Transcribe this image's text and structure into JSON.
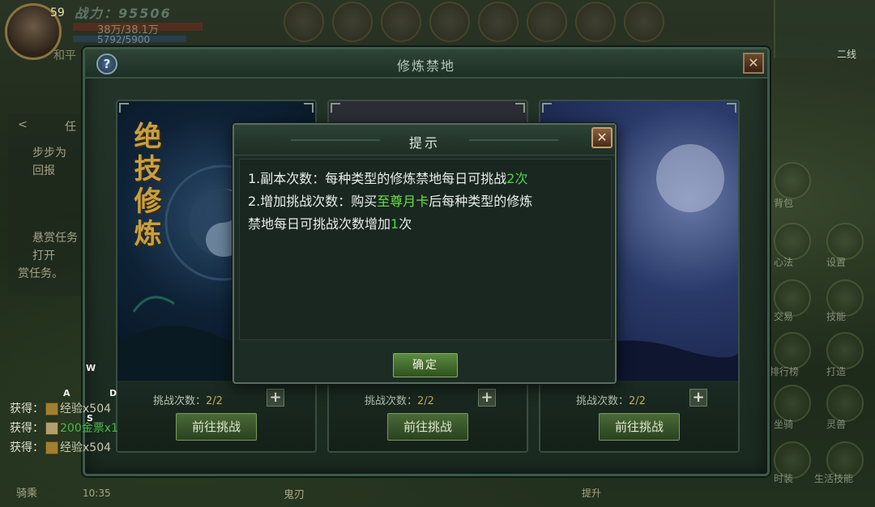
{
  "hud": {
    "level": "59",
    "power": "战力：95506",
    "hp": "38万/38.1万",
    "mp": "5792/5900",
    "mode": "和平",
    "server_line": "二线",
    "time": "10:35"
  },
  "main_window": {
    "title": "修炼禁地",
    "help": "?",
    "close": "✕",
    "cards": [
      {
        "title": "绝技修炼",
        "count_label": "挑战次数：",
        "count": "2/2",
        "button": "前往挑战"
      },
      {
        "title": "",
        "count_label": "挑战次数：",
        "count": "2/2",
        "button": "前往挑战"
      },
      {
        "title": "",
        "count_label": "挑战次数：",
        "count": "2/2",
        "button": "前往挑战"
      }
    ]
  },
  "dialog": {
    "title": "提示",
    "close": "✕",
    "line1_pre": "1.副本次数：每种类型的修炼禁地每日可挑战",
    "line1_hl": "2次",
    "line2_pre": "2.增加挑战次数：购买",
    "line2_hl": "至尊月卡",
    "line2_post": "后每种类型的修炼",
    "line3_pre": "禁地每日可挑战次数增加",
    "line3_hl": "1",
    "line3_post": "次",
    "confirm": "确定"
  },
  "wasd": {
    "w": "W",
    "a": "A",
    "s": "S",
    "d": "D"
  },
  "rewards": [
    {
      "prefix": "获得：",
      "item": "经验x504"
    },
    {
      "prefix": "获得：",
      "item": "200金票x1"
    },
    {
      "prefix": "获得：",
      "item": "经验x504"
    }
  ],
  "left_panel": {
    "tab": "任",
    "task1": "步步为",
    "task1_sub": "回报",
    "task2": "悬赏任务",
    "task2_sub": "打开",
    "task2_sub2": "赏任务。"
  },
  "right_menu": [
    "背包",
    "心法",
    "设置",
    "交易",
    "技能",
    "排行榜",
    "打造",
    "坐骑",
    "灵兽",
    "时装",
    "生活技能"
  ],
  "bottom_labels": {
    "ride": "骑乘",
    "blade": "鬼刃",
    "upgrade": "提升"
  },
  "icons": {
    "help": "question-icon",
    "close": "close-icon",
    "plus": "plus-icon"
  }
}
